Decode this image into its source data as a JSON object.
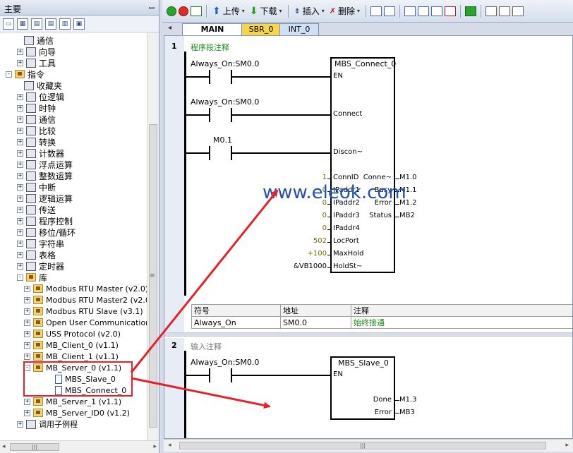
{
  "left_panel": {
    "title": "主要",
    "pin": "ꟷ",
    "tree": [
      {
        "label": "通信",
        "indent": 2,
        "expander": "",
        "icon": "computer-icon"
      },
      {
        "label": "向导",
        "indent": 1,
        "expander": "+",
        "icon": "wizard-icon"
      },
      {
        "label": "工具",
        "indent": 1,
        "expander": "+",
        "icon": "tools-icon"
      },
      {
        "label": "指令",
        "indent": 0,
        "expander": "−",
        "icon": "folder-icon"
      },
      {
        "label": "收藏夹",
        "indent": 2,
        "expander": "",
        "icon": "favorites-icon"
      },
      {
        "label": "位逻辑",
        "indent": 1,
        "expander": "+",
        "icon": "bit-logic-icon"
      },
      {
        "label": "时钟",
        "indent": 1,
        "expander": "+",
        "icon": "clock-icon"
      },
      {
        "label": "通信",
        "indent": 1,
        "expander": "+",
        "icon": "comm-icon"
      },
      {
        "label": "比较",
        "indent": 1,
        "expander": "+",
        "icon": "compare-icon"
      },
      {
        "label": "转换",
        "indent": 1,
        "expander": "+",
        "icon": "convert-icon"
      },
      {
        "label": "计数器",
        "indent": 1,
        "expander": "+",
        "icon": "counter-icon"
      },
      {
        "label": "浮点运算",
        "indent": 1,
        "expander": "+",
        "icon": "float-math-icon"
      },
      {
        "label": "整数运算",
        "indent": 1,
        "expander": "+",
        "icon": "int-math-icon"
      },
      {
        "label": "中断",
        "indent": 1,
        "expander": "+",
        "icon": "interrupt-icon"
      },
      {
        "label": "逻辑运算",
        "indent": 1,
        "expander": "+",
        "icon": "logic-op-icon"
      },
      {
        "label": "传送",
        "indent": 1,
        "expander": "+",
        "icon": "move-icon"
      },
      {
        "label": "程序控制",
        "indent": 1,
        "expander": "+",
        "icon": "program-control-icon"
      },
      {
        "label": "移位/循环",
        "indent": 1,
        "expander": "+",
        "icon": "shift-icon"
      },
      {
        "label": "字符串",
        "indent": 1,
        "expander": "+",
        "icon": "string-icon"
      },
      {
        "label": "表格",
        "indent": 1,
        "expander": "+",
        "icon": "table-icon"
      },
      {
        "label": "定时器",
        "indent": 1,
        "expander": "+",
        "icon": "timer-icon"
      },
      {
        "label": "库",
        "indent": 1,
        "expander": "−",
        "icon": "library-folder-icon"
      },
      {
        "label": "Modbus RTU Master (v2.0)",
        "indent": 2,
        "expander": "+",
        "icon": "folder-icon"
      },
      {
        "label": "Modbus RTU Master2 (v2.0",
        "indent": 2,
        "expander": "+",
        "icon": "folder-icon"
      },
      {
        "label": "Modbus RTU Slave (v3.1)",
        "indent": 2,
        "expander": "+",
        "icon": "folder-icon"
      },
      {
        "label": "Open User Communication",
        "indent": 2,
        "expander": "+",
        "icon": "folder-icon"
      },
      {
        "label": "USS Protocol (v2.0)",
        "indent": 2,
        "expander": "+",
        "icon": "folder-icon"
      },
      {
        "label": "MB_Client_0 (v1.1)",
        "indent": 2,
        "expander": "+",
        "icon": "folder-icon"
      },
      {
        "label": "MB_Client_1 (v1.1)",
        "indent": 2,
        "expander": "+",
        "icon": "folder-icon"
      },
      {
        "label": "MB_Server_0 (v1.1)",
        "indent": 2,
        "expander": "−",
        "icon": "folder-icon"
      },
      {
        "label": "MBS_Slave_0",
        "indent": 3,
        "expander": "",
        "icon": "document-icon"
      },
      {
        "label": "MBS_Connect_0",
        "indent": 3,
        "expander": "",
        "icon": "document-icon"
      },
      {
        "label": "MB_Server_1 (v1.1)",
        "indent": 2,
        "expander": "+",
        "icon": "folder-icon"
      },
      {
        "label": "MB_Server_ID0 (v1.2)",
        "indent": 2,
        "expander": "+",
        "icon": "folder-icon"
      },
      {
        "label": "调用子例程",
        "indent": 1,
        "expander": "+",
        "icon": "call-subroutine-icon"
      }
    ]
  },
  "toolbar": {
    "upload": "上传",
    "download": "下载",
    "insert": "插入",
    "delete": "删除"
  },
  "tabs": [
    {
      "label": "MAIN",
      "active": true
    },
    {
      "label": "SBR_0",
      "active": false
    },
    {
      "label": "INT_0",
      "active": false
    }
  ],
  "network1": {
    "number": "1",
    "comment": "程序段注释",
    "block_title": "MBS_Connect_0",
    "contacts": [
      "Always_On:SM0.0",
      "Always_On:SM0.0",
      "M0.1"
    ],
    "bool_inputs": [
      "EN",
      "Connect",
      "Discon~"
    ],
    "param_inputs": [
      {
        "name": "ConnID",
        "value": "1"
      },
      {
        "name": "IPaddr1",
        "value": "0"
      },
      {
        "name": "IPaddr2",
        "value": "0"
      },
      {
        "name": "IPaddr3",
        "value": "0"
      },
      {
        "name": "IPaddr4",
        "value": "0"
      },
      {
        "name": "LocPort",
        "value": "502"
      },
      {
        "name": "MaxHold",
        "value": "+100"
      },
      {
        "name": "HoldSt~",
        "value": "&VB1000"
      }
    ],
    "outputs": [
      {
        "name": "Conne~",
        "value": "M1.0"
      },
      {
        "name": "Busy",
        "value": "M1.1"
      },
      {
        "name": "Error",
        "value": "M1.2"
      },
      {
        "name": "Status",
        "value": "MB2"
      }
    ],
    "symbol_table": {
      "headers": [
        "符号",
        "地址",
        "注释"
      ],
      "row": [
        "Always_On",
        "SM0.0",
        "始终接通"
      ]
    }
  },
  "network2": {
    "number": "2",
    "comment": "输入注释",
    "block_title": "MBS_Slave_0",
    "contact": "Always_On:SM0.0",
    "input": "EN",
    "outputs": [
      {
        "name": "Done",
        "value": "M1.3"
      },
      {
        "name": "Error",
        "value": "MB3"
      }
    ]
  },
  "watermark": "www.eleok.com",
  "colors": {
    "arrow": "#e8202a",
    "highlight": "#e8202a",
    "comment_green": "#178a17",
    "active_tab": "#ffffff",
    "sbr_tab": "#f5d54a",
    "int_tab": "#cfe0f5"
  }
}
